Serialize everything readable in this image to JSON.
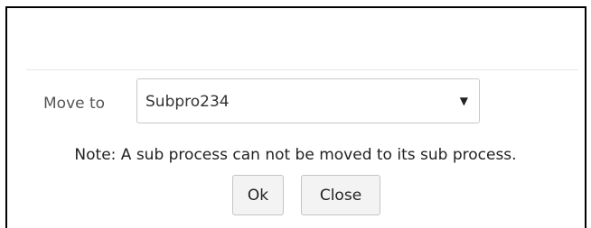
{
  "dialog": {
    "move_to_label": "Move to",
    "move_to_select": {
      "selected_value": "Subpro234",
      "arrow_glyph": "▼"
    },
    "note": "Note: A sub process can not be moved to its sub process.",
    "buttons": {
      "ok_label": "Ok",
      "close_label": "Close"
    }
  }
}
